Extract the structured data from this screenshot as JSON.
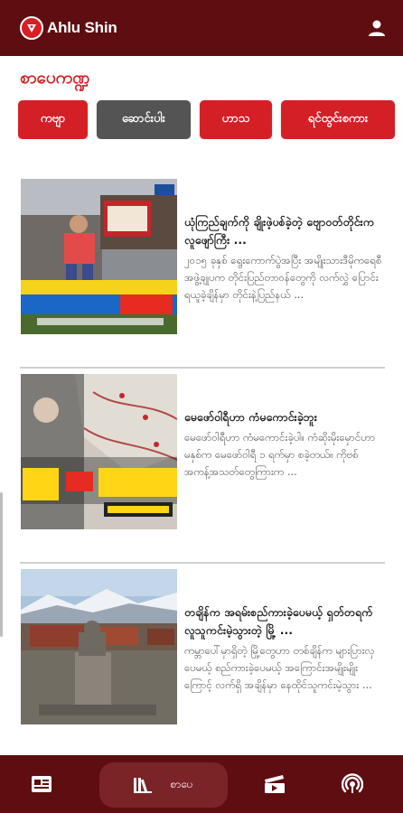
{
  "app": {
    "name": "Ahlu Shin",
    "brand_color": "#5e0d10",
    "accent_color": "#d51f26"
  },
  "section": {
    "title": "စာပေကဏ္ဍ"
  },
  "categories": {
    "selected_index": 1,
    "items": [
      {
        "label": "ကဗျာ"
      },
      {
        "label": "ဆောင်းပါး"
      },
      {
        "label": "ဟာသ"
      },
      {
        "label": "ရင်ထွင်းစကား"
      }
    ]
  },
  "articles": [
    {
      "title": "ယုံကြည်ချက်ကို ချိုးဖဲ့ပစ်ခဲ့တဲ့ ဗျောဝတ်တိုင်းက လူဖျော်ကြီး ...",
      "snippet": "၂၀၁၅ ခုနှစ် ရွေးကောက်ပွဲအပြီး အမျိုးသားဒီမိုကရေစီအဖွဲ့ချုပက တိုင်းပြည်တာဝန်တွေကို လက်လွှဲ ပြောင်းရယူခဲ့ချိန်မှာ တိုင်းနဲ့ပြည်နယ် ...",
      "image_caption": "ယုံကြည်ချက်ကို ချိုးဖဲ့ပစ်ခဲ့တဲ့ ဗျောဝတ်တိုင်းက လူဖျော်ကြီး"
    },
    {
      "title": "မေဖော်ဝါရီဟာ ကံမကောင်းခဲ့ဘူး",
      "snippet": "မေဖော်ဝါရီဟာ ကံမကောင်းခဲ့ပါ။ ကံဆိုးမိုးမှောင်ဟာ မနှစ်က မေဖော်ဝါရီ ၁ ရက်မှာ စခဲ့တယ်။ ကိုဗစ် အကန့်အသတ်တွေကြားက ...",
      "image_caption": "ဖော်ဝါရီဟာ ကံမကောင်း"
    },
    {
      "title": "တချိန်က အရမ်းစည်ကားခဲ့ပေမယ့် ရှတ်တရက် လူသူကင်းမဲ့သွားတဲ့ မြို့ ...",
      "snippet": "ကမ္ဘာပေါ်မှာရှိတဲ့ မြို့တွေဟာ တစ်ချိန်က များပြားလှပေမယ့် စည်ကားခဲ့ပေမယ့် အကြောင်းအမျိုးမျိုးကြောင့် လက်ရှိ အချိန်မှာ နေထိုင်သူကင်းမဲ့သွား ...",
      "image_caption": ""
    }
  ],
  "bottom_nav": {
    "active_index": 1,
    "items": [
      {
        "icon": "news-icon",
        "label": ""
      },
      {
        "icon": "books-icon",
        "label": "စာပေ"
      },
      {
        "icon": "video-icon",
        "label": ""
      },
      {
        "icon": "podcast-icon",
        "label": ""
      }
    ]
  }
}
